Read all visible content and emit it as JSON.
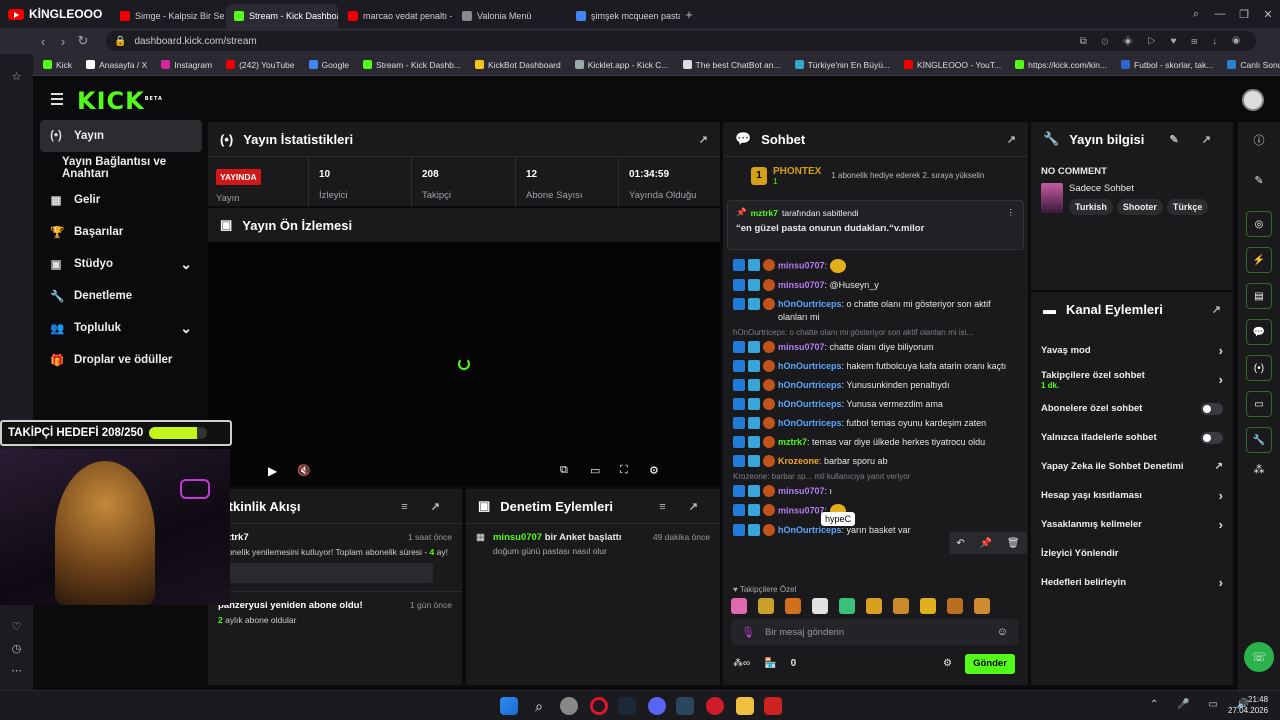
{
  "browser": {
    "profile_name": "KİNGLEOOO",
    "tabs": [
      {
        "label": "Simge - Kalpsiz Bir Serseri",
        "color": "#e00",
        "active": false
      },
      {
        "label": "Stream - Kick Dashboard",
        "color": "#53fc18",
        "active": true
      },
      {
        "label": "marcao vedat penaltı - Yo",
        "color": "#e00",
        "active": false
      },
      {
        "label": "Valonia Menü",
        "color": "#888",
        "active": false
      },
      {
        "label": "şimşek mcqueen pasta - G",
        "color": "#4285f4",
        "active": false
      }
    ],
    "url": "dashboard.kick.com/stream",
    "bookmarks": [
      {
        "label": "Kick",
        "color": "#53fc18"
      },
      {
        "label": "Anasayfa / X",
        "color": "#ffffff"
      },
      {
        "label": "Instagram",
        "color": "#d6249f"
      },
      {
        "label": "(242) YouTube",
        "color": "#e00"
      },
      {
        "label": "Google",
        "color": "#4285f4"
      },
      {
        "label": "Stream - Kick Dashb...",
        "color": "#53fc18"
      },
      {
        "label": "KickBot Dashboard",
        "color": "#f5c518"
      },
      {
        "label": "Kicklet.app - Kick C...",
        "color": "#9aa"
      },
      {
        "label": "The best ChatBot an...",
        "color": "#ddd"
      },
      {
        "label": "Türkiye'nin En Büyü...",
        "color": "#3ac"
      },
      {
        "label": "KİNGLEOOO - YouT...",
        "color": "#e00"
      },
      {
        "label": "https://kick.com/kin...",
        "color": "#53fc18"
      },
      {
        "label": "Futbol - skorlar, tak...",
        "color": "#3366cc"
      },
      {
        "label": "Canlı Sonuçlar - İdd...",
        "color": "#2a7fcf"
      }
    ]
  },
  "app": {
    "logo": "KICK",
    "logo_sup": "BETA",
    "nav": [
      {
        "label": "Yayın",
        "icon": "(•)",
        "active": true
      },
      {
        "label": "Yayın Bağlantısı ve Anahtarı",
        "icon": "",
        "active": false
      },
      {
        "label": "Gelir",
        "icon": "▦",
        "active": false
      },
      {
        "label": "Başarılar",
        "icon": "🏆",
        "active": false
      },
      {
        "label": "Stüdyo",
        "icon": "▣",
        "active": false,
        "expand": true
      },
      {
        "label": "Denetleme",
        "icon": "🔧",
        "active": false
      },
      {
        "label": "Topluluk",
        "icon": "👥",
        "active": false,
        "expand": true
      },
      {
        "label": "Droplar ve ödüller",
        "icon": "🎁",
        "active": false
      }
    ]
  },
  "stats": {
    "title": "Yayın İstatistikleri",
    "live_badge": "YAYINDA",
    "live_label": "Yayın",
    "items": [
      {
        "value": "10",
        "label": "İzleyici"
      },
      {
        "value": "208",
        "label": "Takipçi"
      },
      {
        "value": "12",
        "label": "Abone Sayısı"
      },
      {
        "value": "01:34:59",
        "label": "Yayında Olduğu"
      }
    ]
  },
  "preview": {
    "title": "Yayın Ön İzlemesi"
  },
  "overlay": {
    "follower_goal": "TAKİPÇİ HEDEFİ 208/250",
    "progress": 0.83
  },
  "activity": {
    "title": "Etkinlik Akışı",
    "items": [
      {
        "user": "mztrk7",
        "time": "1 saat önce",
        "text": "abonelik yenilemesini kutluyor! Toplam abonelik süresi - ",
        "highlight": "4",
        "suffix": " ay!"
      },
      {
        "user": "panzeryusi yeniden abone oldu!",
        "time": "1 gün önce",
        "highlight": "2",
        "text": " aylık abone oldular"
      }
    ]
  },
  "moderation": {
    "title": "Denetim Eylemleri",
    "items": [
      {
        "user": "minsu0707",
        "action": " bir Anket başlattı",
        "time": "49 dakika önce",
        "detail": "doğum günü pastası nasıl olur"
      }
    ]
  },
  "chat": {
    "title": "Sohbet",
    "top_gifter": {
      "name": "PHONTEX",
      "rank": "1",
      "count": "1",
      "text": "1 abonelik hediye ederek 2. sıraya yükselin"
    },
    "pinned": {
      "by": "mztrk7",
      "by_suffix": " tarafından sabitlendi",
      "text": "“en güzel pasta onurun dudakları.“v.milor"
    },
    "messages": [
      {
        "user": "minsu0707",
        "color": "#b57bf0",
        "text": "",
        "emoji": true
      },
      {
        "user": "minsu0707",
        "color": "#b57bf0",
        "text": "@Huseyn_y"
      },
      {
        "user": "hOnOurtriceps",
        "color": "#5aa8ff",
        "text": "o chatte olanı mi gösteriyor son aktif olanları mi"
      },
      {
        "reply": "hOnOurtriceps: o chatte olanı mi gösteriyor son aktif olanları mi isi..."
      },
      {
        "user": "minsu0707",
        "color": "#b57bf0",
        "text": "chatte olanı diye biliyorum"
      },
      {
        "user": "hOnOurtriceps",
        "color": "#5aa8ff",
        "text": "hakem futbolcuya kafa atarin oranı kaçtı"
      },
      {
        "user": "hOnOurtriceps",
        "color": "#5aa8ff",
        "text": "Yunusunkinden penaltıydı"
      },
      {
        "user": "hOnOurtriceps",
        "color": "#5aa8ff",
        "text": "Yunusa vermezdim ama"
      },
      {
        "user": "hOnOurtriceps",
        "color": "#5aa8ff",
        "text": "futbol temas oyunu kardeşim zaten"
      },
      {
        "user": "mztrk7",
        "color": "#53fc18",
        "text": "temas var diye ülkede herkes tiyatrocu oldu"
      },
      {
        "user": "Krozeone",
        "color": "#f5a623",
        "text": "barbar sporu ab"
      },
      {
        "reply": "Krozeone: barbar sp... mil kullanıcıya yanıt veriyor"
      },
      {
        "user": "minsu0707",
        "color": "#b57bf0",
        "text": "ı"
      },
      {
        "user": "minsu0707",
        "color": "#b57bf0",
        "text": "",
        "emoji": true
      },
      {
        "user": "hOnOurtriceps",
        "color": "#5aa8ff",
        "text": "yarın basket var"
      }
    ],
    "tooltip": "hypeC",
    "emote_section": "Takipçilere Özel",
    "input_placeholder": "Bir mesaj gönderin",
    "points": "0",
    "send_label": "Gönder"
  },
  "info": {
    "title": "Yayın bilgisi",
    "stream_title": "NO COMMENT",
    "category": "Sadece Sohbet",
    "tags": [
      "Turkish",
      "Shooter",
      "Türkçe"
    ]
  },
  "channel": {
    "title": "Kanal Eylemleri",
    "rows": [
      {
        "label": "Yavaş mod",
        "kind": "chev"
      },
      {
        "label": "Takipçilere özel sohbet",
        "sub": "1 dk.",
        "kind": "chev"
      },
      {
        "label": "Abonelere özel sohbet",
        "kind": "toggle"
      },
      {
        "label": "Yalnızca ifadelerle sohbet",
        "kind": "toggle"
      },
      {
        "label": "Yapay Zeka ile Sohbet Denetimi",
        "kind": "ext"
      },
      {
        "label": "Hesap yaşı kısıtlaması",
        "kind": "chev"
      },
      {
        "label": "Yasaklanmış kelimeler",
        "kind": "chev"
      },
      {
        "label": "İzleyici Yönlendir",
        "kind": "none"
      },
      {
        "label": "Hedefleri belirleyin",
        "kind": "chev"
      }
    ]
  },
  "taskbar": {
    "time": "21:48",
    "date": "27.04.2026"
  }
}
